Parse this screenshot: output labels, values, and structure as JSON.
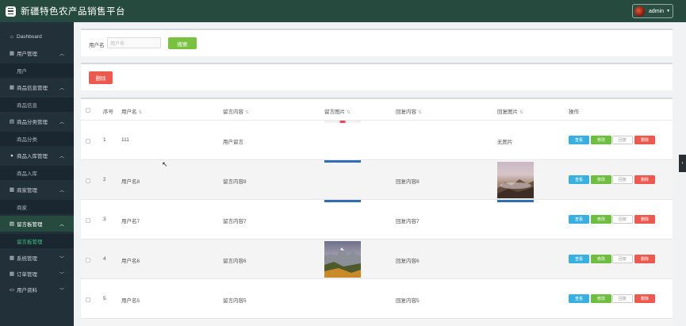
{
  "header": {
    "title": "新疆特色农产品销售平台",
    "user": "admin"
  },
  "sidebar": {
    "items": [
      {
        "label": "Dashboard",
        "icon": "home-icon"
      },
      {
        "label": "用户管理",
        "icon": "grid-icon",
        "sub": "用户"
      },
      {
        "label": "商品信息管理",
        "icon": "grid-icon",
        "sub": "商品信息"
      },
      {
        "label": "商品分类管理",
        "icon": "folder-icon",
        "sub": "商品分类"
      },
      {
        "label": "商品入库管理",
        "icon": "pin-icon",
        "sub": "商品入库"
      },
      {
        "label": "商家管理",
        "icon": "grid-icon",
        "sub": "商家"
      },
      {
        "label": "留言板管理",
        "icon": "list-icon",
        "sub": "留言板管理"
      },
      {
        "label": "系统管理",
        "icon": "grid-icon"
      },
      {
        "label": "订单管理",
        "icon": "grid-icon"
      },
      {
        "label": "用户资料",
        "icon": "user-icon"
      }
    ]
  },
  "search": {
    "label": "用户名",
    "placeholder": "用户名",
    "button": "搜索"
  },
  "actions": {
    "delete": "删除"
  },
  "table": {
    "headers": {
      "index": "序号",
      "username": "用户名",
      "content": "留言内容",
      "image": "留言图片",
      "reply": "回复内容",
      "reply_image": "回复图片",
      "ops": "操作"
    },
    "row_buttons": {
      "view": "查看",
      "edit": "修改",
      "reply": "回复",
      "delete": "删除"
    },
    "rows": [
      {
        "index": "1",
        "username": "111",
        "content": "用户留言",
        "reply": "",
        "reply_image_text": "无图片"
      },
      {
        "index": "2",
        "username": "用户名8",
        "content": "留言内容8",
        "reply": "回复内容8",
        "reply_image_text": ""
      },
      {
        "index": "3",
        "username": "用户名7",
        "content": "留言内容7",
        "reply": "回复内容7",
        "reply_image_text": ""
      },
      {
        "index": "4",
        "username": "用户名6",
        "content": "留言内容6",
        "reply": "回复内容6",
        "reply_image_text": ""
      },
      {
        "index": "5",
        "username": "用户名5",
        "content": "留言内容5",
        "reply": "回复内容5",
        "reply_image_text": ""
      }
    ]
  },
  "colors": {
    "header_bg": "#264a3e",
    "sidebar_bg": "#22303a",
    "active_sub": "#3fbf7f",
    "btn_view": "#3ab0e0",
    "btn_edit": "#6fbe3f",
    "btn_delete": "#ec5a4f"
  }
}
